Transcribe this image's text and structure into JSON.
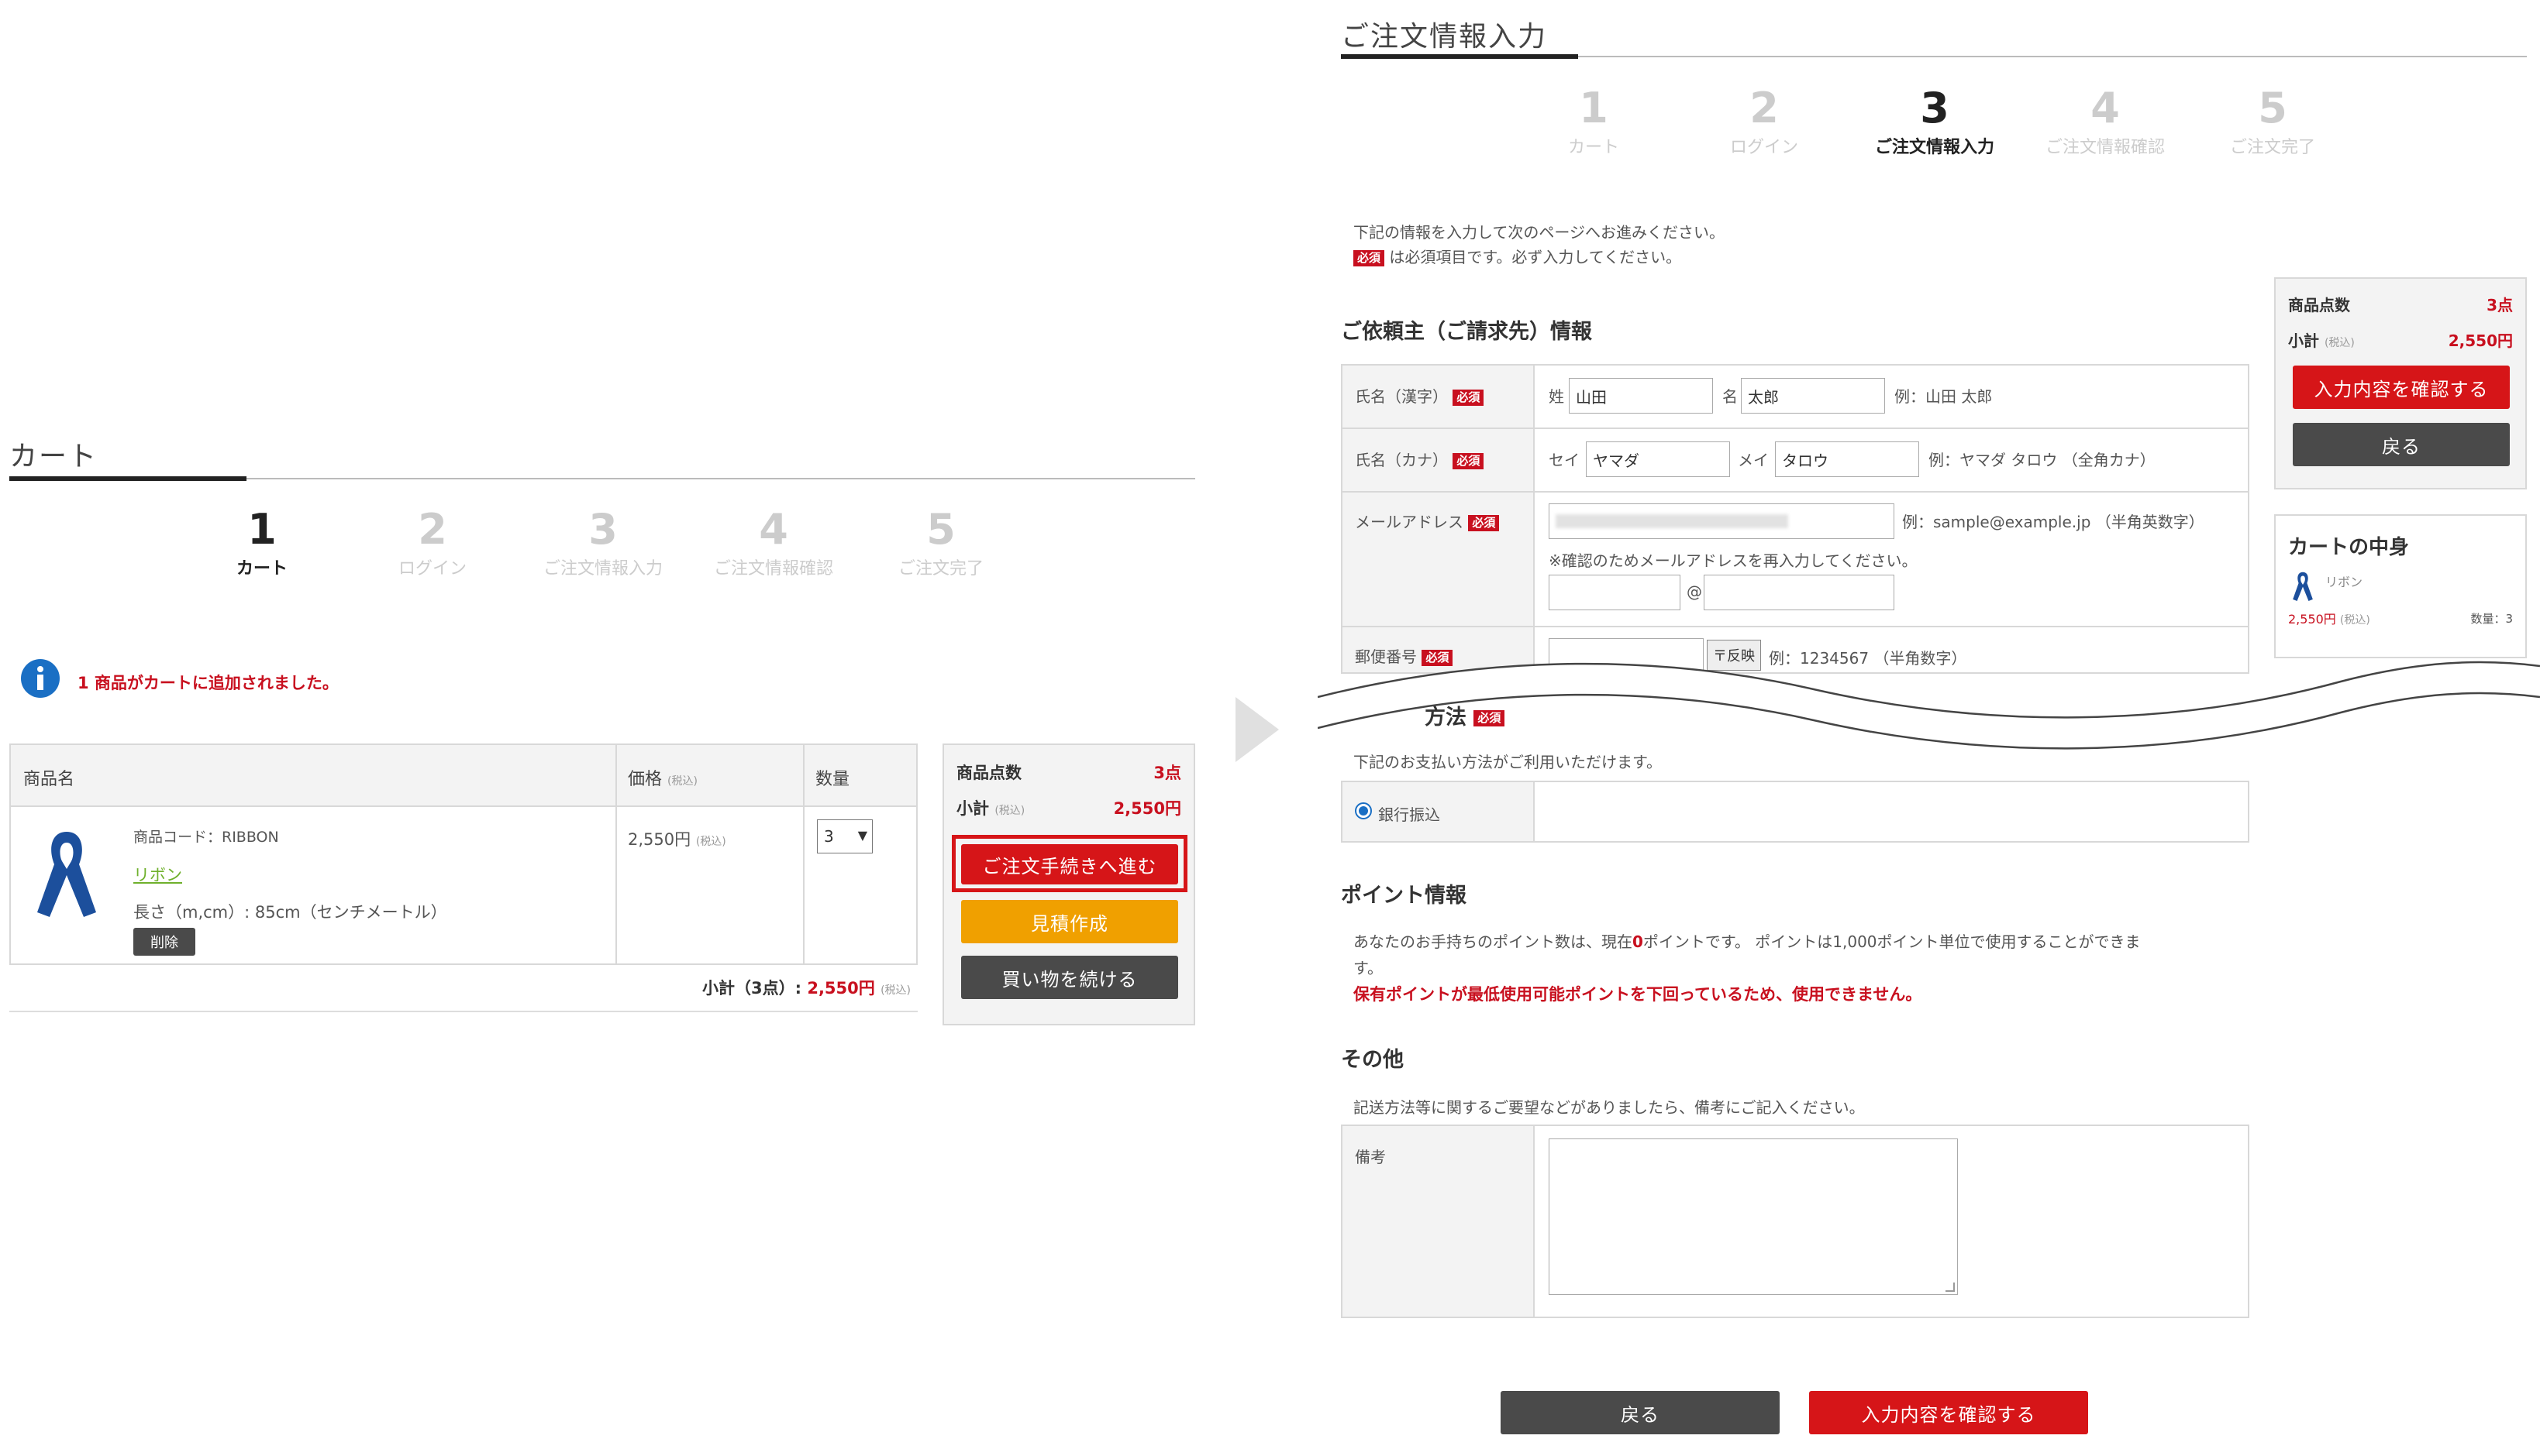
{
  "cart": {
    "title": "カート",
    "steps": [
      {
        "num": "1",
        "label": "カート"
      },
      {
        "num": "2",
        "label": "ログイン"
      },
      {
        "num": "3",
        "label": "ご注文情報入力"
      },
      {
        "num": "4",
        "label": "ご注文情報確認"
      },
      {
        "num": "5",
        "label": "ご注文完了"
      }
    ],
    "notice": "1 商品がカートに追加されました。",
    "table": {
      "col_name": "商品名",
      "col_price": "価格",
      "col_price_note": "(税込)",
      "col_qty": "数量",
      "item": {
        "code": "商品コード：RIBBON",
        "name": "リボン",
        "option": "長さ（m,cm）: 85cm（センチメートル）",
        "delete_label": "削除",
        "price": "2,550円",
        "price_note": "(税込)",
        "qty": "3"
      },
      "subtotal_label": "小計（3点）: ",
      "subtotal_value": "2,550円",
      "subtotal_note": "(税込)"
    },
    "summary": {
      "count_label": "商品点数",
      "count_value": "3点",
      "subtotal_label": "小計",
      "subtotal_note": "(税込)",
      "subtotal_value": "2,550円",
      "checkout_btn": "ご注文手続きへ進む",
      "quote_btn": "見積作成",
      "continue_btn": "買い物を続ける"
    }
  },
  "order": {
    "title": "ご注文情報入力",
    "steps": [
      {
        "num": "1",
        "label": "カート"
      },
      {
        "num": "2",
        "label": "ログイン"
      },
      {
        "num": "3",
        "label": "ご注文情報入力"
      },
      {
        "num": "4",
        "label": "ご注文情報確認"
      },
      {
        "num": "5",
        "label": "ご注文完了"
      }
    ],
    "intro_line1": "下記の情報を入力して次のページへお進みください。",
    "intro_line2": "は必須項目です。必ず入力してください。",
    "required_badge": "必須",
    "client_section": "ご依頼主（ご請求先）情報",
    "fields": {
      "name_kanji_label": "氏名（漢字）",
      "sei_prefix": "姓",
      "sei_value": "山田",
      "mei_prefix": "名",
      "mei_value": "太郎",
      "name_kanji_example": "例：山田 太郎",
      "name_kana_label": "氏名（カナ）",
      "sei_kana_prefix": "セイ",
      "sei_kana_value": "ヤマダ",
      "mei_kana_prefix": "メイ",
      "mei_kana_value": "タロウ",
      "name_kana_example": "例：ヤマダ タロウ （全角カナ）",
      "email_label": "メールアドレス",
      "email_example": "例：sample@example.jp （半角英数字）",
      "email_confirm_note": "※確認のためメールアドレスを再入力してください。",
      "at_sign": "@",
      "postal_label": "郵便番号",
      "postal_button": "〒反映",
      "postal_example": "例：1234567 （半角数字）"
    },
    "payment_section": "方法",
    "payment_note": "下記のお支払い方法がご利用いただけます。",
    "payment_option": "銀行振込",
    "points_section": "ポイント情報",
    "points_text_a": "あなたのお手持ちのポイント数は、現在",
    "points_value": "0",
    "points_text_b": "ポイントです。 ポイントは1,000ポイント単位で使用することができま",
    "points_text_c": "す。",
    "points_warning": "保有ポイントが最低使用可能ポイントを下回っているため、使用できません。",
    "other_section": "その他",
    "other_note": "記送方法等に関するご要望などがありましたら、備考にご記入ください。",
    "remarks_label": "備考",
    "back_btn": "戻る",
    "confirm_btn": "入力内容を確認する"
  },
  "sidebar": {
    "count_label": "商品点数",
    "count_value": "3点",
    "subtotal_label": "小計",
    "subtotal_note": "(税込)",
    "subtotal_value": "2,550円",
    "confirm_btn": "入力内容を確認する",
    "back_btn": "戻る",
    "cart_title": "カートの中身",
    "item_name": "リボン",
    "item_price": "2,550円",
    "item_price_note": "(税込)",
    "item_qty": "数量：3"
  },
  "colors": {
    "accent_red": "#d61518",
    "orange": "#f0a000",
    "dark_button": "#4a4a4a",
    "info_blue": "#1a6fc4",
    "ribbon_blue": "#1c4f9c"
  }
}
